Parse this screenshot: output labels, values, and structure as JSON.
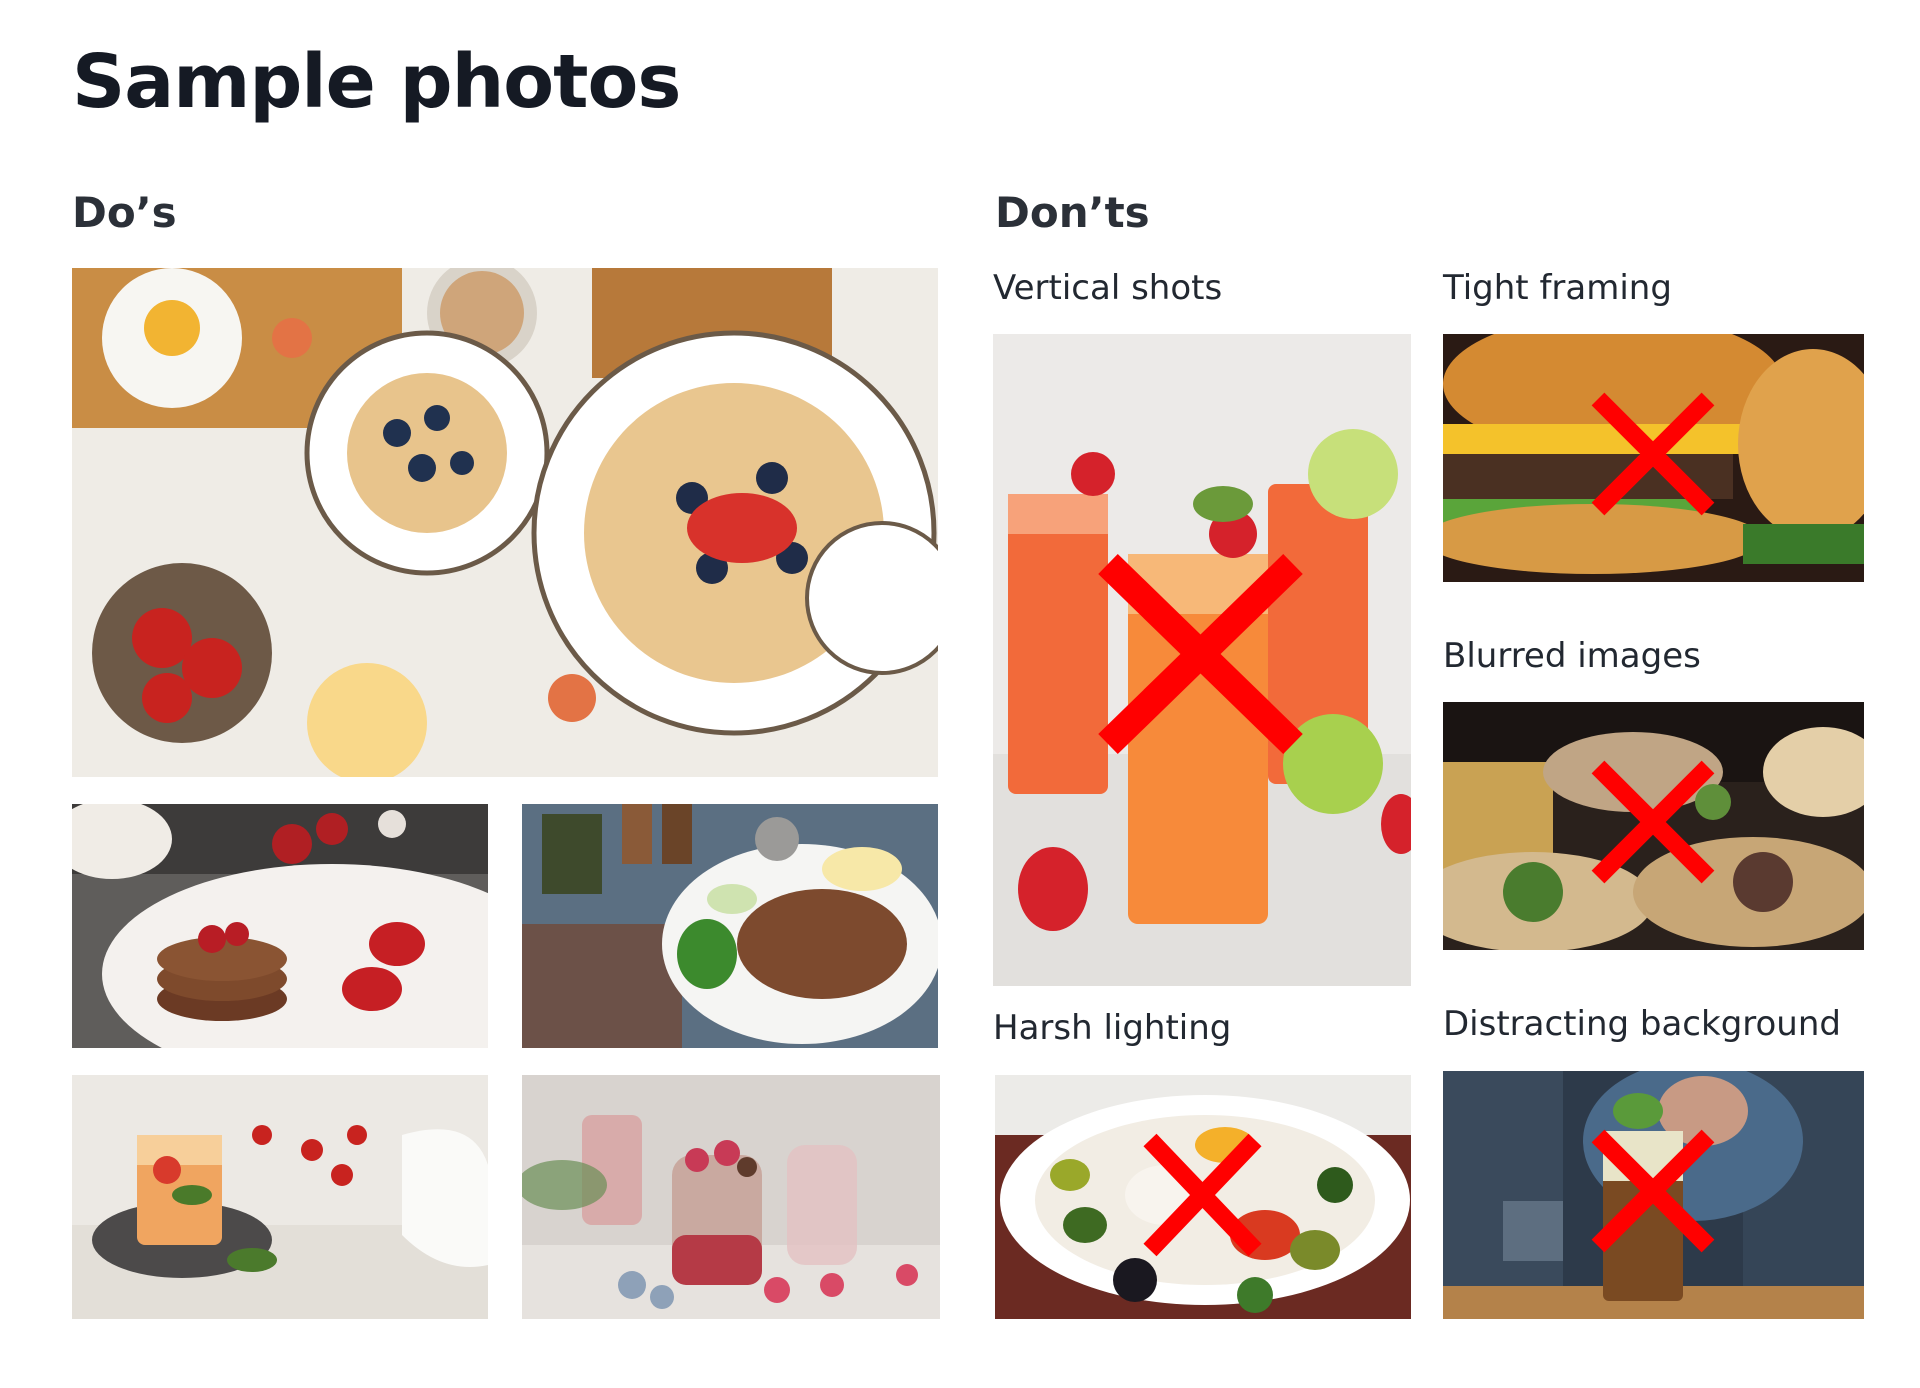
{
  "page": {
    "title": "Sample photos"
  },
  "dos": {
    "heading": "Do’s",
    "photos": [
      {
        "icon": "breakfast-spread-photo"
      },
      {
        "icon": "pancakes-photo"
      },
      {
        "icon": "grilled-meat-plate-photo"
      },
      {
        "icon": "fruit-cocktail-photo"
      },
      {
        "icon": "berry-parfait-photo"
      }
    ]
  },
  "donts": {
    "heading": "Don’ts",
    "items": [
      {
        "label": "Vertical shots"
      },
      {
        "label": "Tight framing"
      },
      {
        "label": "Blurred images"
      },
      {
        "label": "Harsh lighting"
      },
      {
        "label": "Distracting background"
      }
    ],
    "mark_color": "#ff0000"
  }
}
